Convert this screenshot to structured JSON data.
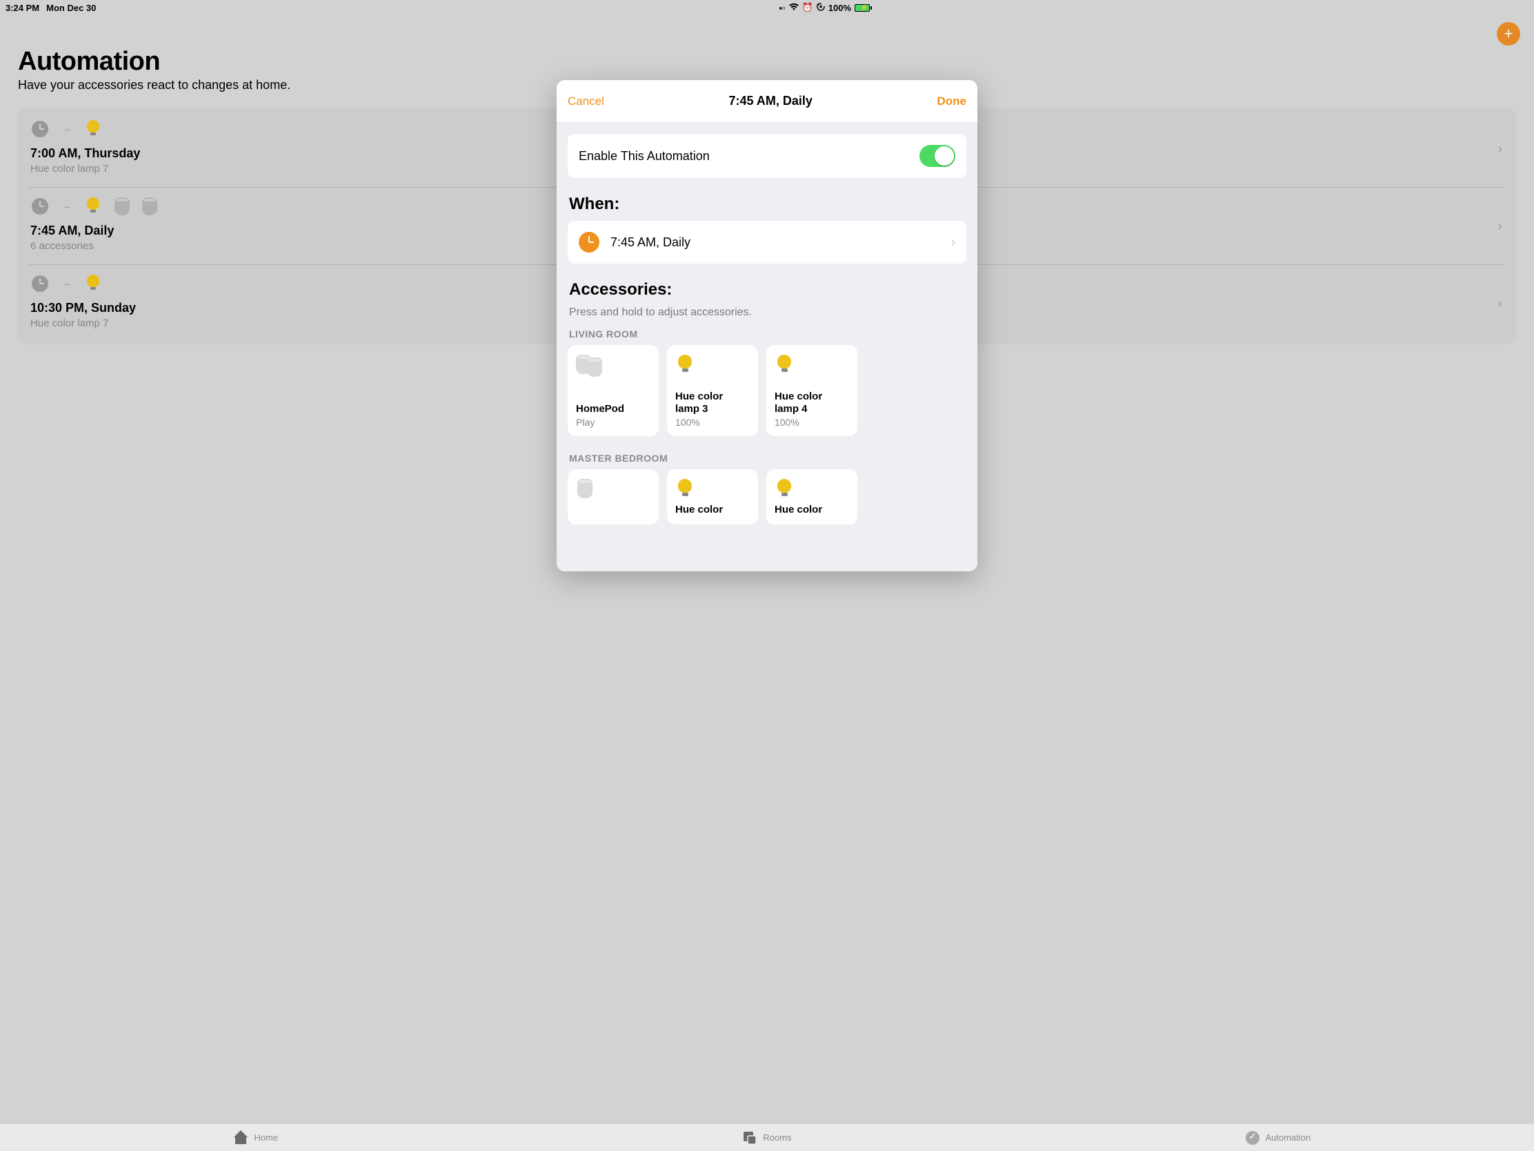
{
  "status": {
    "time": "3:24 PM",
    "date": "Mon Dec 30",
    "battery": "100%"
  },
  "page": {
    "title": "Automation",
    "subtitle": "Have your accessories react to changes at home.",
    "automations": [
      {
        "title": "7:00 AM, Thursday",
        "sub": "Hue color lamp 7"
      },
      {
        "title": "7:45 AM, Daily",
        "sub": "6 accessories"
      },
      {
        "title": "10:30 PM, Sunday",
        "sub": "Hue color lamp 7"
      }
    ]
  },
  "modal": {
    "cancel": "Cancel",
    "done": "Done",
    "title": "7:45 AM, Daily",
    "enable_label": "Enable This Automation",
    "when_heading": "When:",
    "when_value": "7:45 AM, Daily",
    "accessories_heading": "Accessories:",
    "accessories_hint": "Press and hold to adjust accessories.",
    "groups": [
      {
        "name": "LIVING ROOM",
        "tiles": [
          {
            "icon": "homepod-pair",
            "title": "HomePod",
            "sub": "Play"
          },
          {
            "icon": "bulb",
            "title": "Hue color lamp 3",
            "sub": "100%"
          },
          {
            "icon": "bulb",
            "title": "Hue color lamp 4",
            "sub": "100%"
          }
        ]
      },
      {
        "name": "MASTER BEDROOM",
        "tiles": [
          {
            "icon": "homepod",
            "title": "",
            "sub": ""
          },
          {
            "icon": "bulb",
            "title": "Hue color",
            "sub": ""
          },
          {
            "icon": "bulb",
            "title": "Hue color",
            "sub": ""
          }
        ]
      }
    ]
  },
  "tabs": {
    "home": "Home",
    "rooms": "Rooms",
    "automation": "Automation"
  }
}
